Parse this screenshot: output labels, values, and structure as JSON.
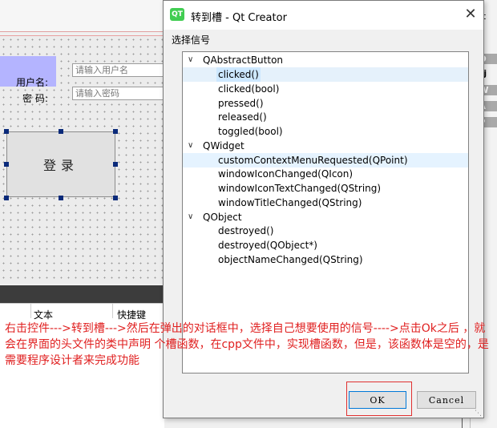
{
  "dialog": {
    "title": "转到槽 - Qt Creator",
    "app_icon_text": "QT",
    "close_glyph": "✕",
    "signal_label": "选择信号",
    "tree": [
      {
        "type": "parent",
        "label": "QAbstractButton",
        "expanded": true
      },
      {
        "type": "child",
        "label": "clicked()",
        "selected": true
      },
      {
        "type": "child",
        "label": "clicked(bool)"
      },
      {
        "type": "child",
        "label": "pressed()"
      },
      {
        "type": "child",
        "label": "released()"
      },
      {
        "type": "child",
        "label": "toggled(bool)"
      },
      {
        "type": "parent",
        "label": "QWidget",
        "expanded": true
      },
      {
        "type": "child",
        "label": "customContextMenuRequested(QPoint)",
        "hovered": true
      },
      {
        "type": "child",
        "label": "windowIconChanged(QIcon)"
      },
      {
        "type": "child",
        "label": "windowIconTextChanged(QString)"
      },
      {
        "type": "child",
        "label": "windowTitleChanged(QString)"
      },
      {
        "type": "parent",
        "label": "QObject",
        "expanded": true
      },
      {
        "type": "child",
        "label": "destroyed()"
      },
      {
        "type": "child",
        "label": "destroyed(QObject*)"
      },
      {
        "type": "child",
        "label": "objectNameChanged(QString)"
      }
    ],
    "ok_label": "OK",
    "cancel_label": "Cancel"
  },
  "designer": {
    "label_user": "用户名:",
    "label_pass": "密  码:",
    "input_user_placeholder": "请输入用户名",
    "input_pass_placeholder": "请输入密码",
    "login_button": "登录",
    "action_col_text": "文本",
    "action_col_shortcut": "快捷键"
  },
  "right_panel": {
    "items": [
      "ent",
      "Bi",
      "QO",
      "obj",
      "QW",
      "QA",
      "QP",
      "ut",
      "lef",
      "at"
    ]
  },
  "annotation": "右击控件--->转到槽--->然后在弹出的对话框中，选择自己想要使用的信号---->点击Ok之后 ，就会在界面的头文件的类中声明   个槽函数，在cpp文件中，实现槽函数，但是，该函数体是空的，是需要程序设计者来完成功能",
  "colors": {
    "selection": "#cde8ff",
    "annotation_red": "#e02020",
    "qt_green": "#41cd52",
    "label_highlight": "#b4b4ff"
  }
}
